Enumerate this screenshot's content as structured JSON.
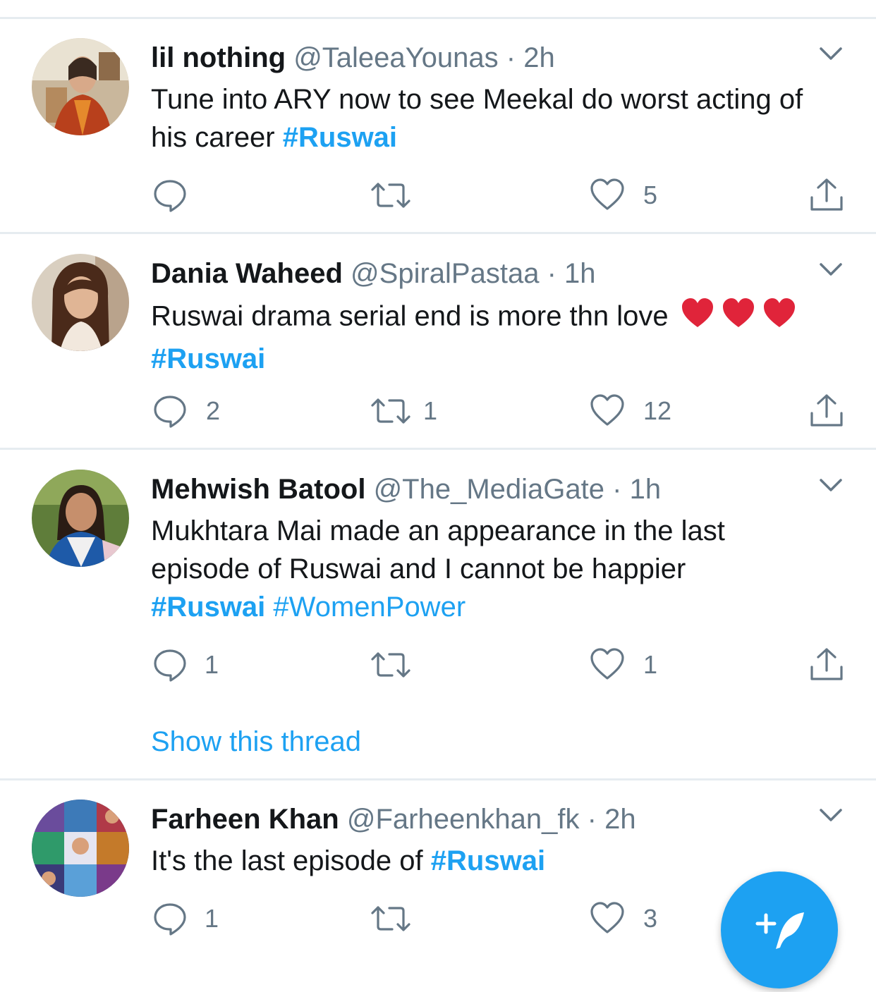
{
  "colors": {
    "accent": "#1da1f2",
    "muted": "#657786",
    "text": "#14171a",
    "divider": "#e6ecf0",
    "emoji_heart": "#e0243a"
  },
  "tweets": [
    {
      "name": "lil nothing",
      "handle": "@TaleeaYounas",
      "sep": "·",
      "time": "2h",
      "text_1": "Tune into ARY now to see Meekal do worst acting of his career ",
      "hashtag_1": "#Ruswai",
      "reply_count": "",
      "retweet_count": "",
      "like_count": "5"
    },
    {
      "name": "Dania Waheed",
      "handle": "@SpiralPastaa",
      "sep": "·",
      "time": "1h",
      "text_1": "Ruswai drama serial end is more thn love",
      "hashtag_1": "#Ruswai",
      "reply_count": "2",
      "retweet_count": "1",
      "like_count": "12"
    },
    {
      "name": "Mehwish Batool",
      "handle": "@The_MediaGate",
      "sep": "·",
      "time": "1h",
      "text_1": "Mukhtara Mai made an appearance in the last episode of Ruswai and I cannot be happier",
      "hashtag_1": "#Ruswai",
      "hashtag_2": "#WomenPower",
      "reply_count": "1",
      "retweet_count": "",
      "like_count": "1",
      "show_thread": "Show this thread"
    },
    {
      "name": "Farheen Khan",
      "handle": "@Farheenkhan_fk",
      "sep": "·",
      "time": "2h",
      "text_1": "It's the last episode of ",
      "hashtag_1": "#Ruswai",
      "reply_count": "1",
      "retweet_count": "",
      "like_count": "3"
    }
  ],
  "icons": {
    "reply": "reply-icon",
    "retweet": "retweet-icon",
    "like": "heart-icon",
    "share": "share-icon",
    "more": "chevron-down-icon",
    "compose": "compose-tweet-icon"
  }
}
